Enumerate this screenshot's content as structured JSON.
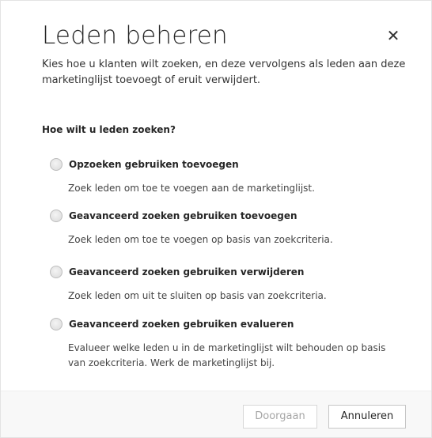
{
  "dialog": {
    "title": "Leden beheren",
    "close_icon": "close-icon",
    "subtitle": "Kies hoe u klanten wilt zoeken, en deze vervolgens als leden aan deze marketinglijst toevoegt of eruit verwijdert.",
    "question": "Hoe wilt u leden zoeken?",
    "options": [
      {
        "label": "Opzoeken gebruiken toevoegen",
        "description": "Zoek leden om toe te voegen aan de marketinglijst.",
        "selected": false
      },
      {
        "label": "Geavanceerd zoeken gebruiken toevoegen",
        "description": "Zoek leden om toe te voegen op basis van zoekcriteria.",
        "selected": false
      },
      {
        "label": "Geavanceerd zoeken gebruiken verwijderen",
        "description": "Zoek leden om uit te sluiten op basis van zoekcriteria.",
        "selected": false
      },
      {
        "label": "Geavanceerd zoeken gebruiken evalueren",
        "description": "Evalueer welke leden u in de marketinglijst wilt behouden op basis van zoekcriteria. Werk de marketinglijst bij.",
        "selected": false
      }
    ],
    "footer": {
      "continue_label": "Doorgaan",
      "continue_disabled": true,
      "cancel_label": "Annuleren"
    }
  }
}
